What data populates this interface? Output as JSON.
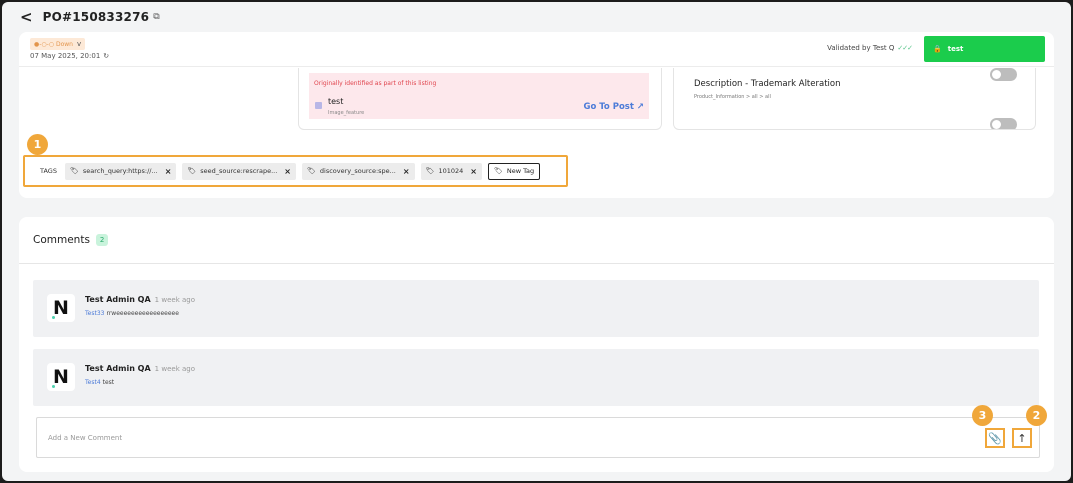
{
  "header": {
    "back_glyph": "<",
    "po_title": "PO#150833276",
    "copy_glyph": "⧉"
  },
  "status": {
    "badge": "●-○-○ Down",
    "chevron": "v",
    "date": "07 May 2025, 20:01",
    "refresh_glyph": "↻",
    "validated_by": "Validated by Test Q",
    "checks": "✓✓✓",
    "action_button": "test",
    "lock_glyph": "🔒"
  },
  "listing": {
    "origin_text": "Originally identified as part of this listing",
    "name": "test",
    "sub": "Image_feature",
    "go_to_post": "Go To Post ↗"
  },
  "description": {
    "title": "Description - Trademark Alteration",
    "path": "Product_Information  >  all  >  all"
  },
  "tags": {
    "label": "TAGS",
    "items": [
      {
        "text": "search_query:https://..."
      },
      {
        "text": "seed_source:rescrape..."
      },
      {
        "text": "discovery_source:spe..."
      },
      {
        "text": "101024"
      }
    ],
    "remove_glyph": "×",
    "tag_glyph": "🏷",
    "new_tag": "New Tag"
  },
  "markers": {
    "m1": "1",
    "m2": "2",
    "m3": "3"
  },
  "comments": {
    "title": "Comments",
    "count": "2",
    "list": [
      {
        "avatar": "N",
        "author": "Test Admin QA",
        "time": "1 week ago",
        "mention": "Test33",
        "text": "rrweeeeeeeeeeeeeeeee"
      },
      {
        "avatar": "N",
        "author": "Test Admin QA",
        "time": "1 week ago",
        "mention": "Test4",
        "text": "test"
      }
    ],
    "input_placeholder": "Add a New Comment",
    "attach_glyph": "📎",
    "send_glyph": "↑"
  },
  "colors": {
    "accent_green": "#1bcc4c",
    "highlight_orange": "#f0a73a",
    "link_blue": "#4c7bd8",
    "alert_red": "#e0454e"
  }
}
